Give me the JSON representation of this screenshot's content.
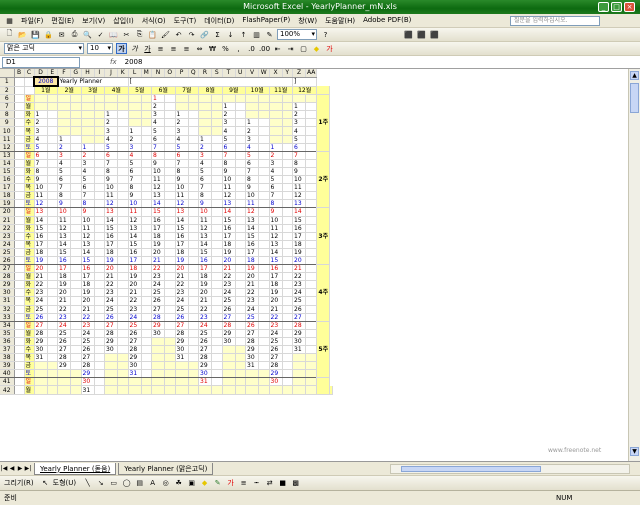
{
  "title": "Microsoft Excel - YearlyPlanner_mN.xls",
  "menu": [
    "파일(F)",
    "편집(E)",
    "보기(V)",
    "삽입(I)",
    "서식(O)",
    "도구(T)",
    "데이터(D)",
    "FlashPaper(P)",
    "창(W)",
    "도움말(H)",
    "Adobe PDF(B)"
  ],
  "help_placeholder": "질문을 입력하십시오.",
  "font_name": "맑은 고딕",
  "font_size": "10",
  "zoom": "100%",
  "name_box": "D1",
  "formula_fx": "fx",
  "formula_value": "2008",
  "cells": {
    "year": "2008",
    "planner_title": "Yearly Planner",
    "bracket_open": "[",
    "bracket_close": "]"
  },
  "columns": [
    "B",
    "C",
    "D",
    "E",
    "F",
    "G",
    "H",
    "I",
    "J",
    "K",
    "L",
    "M",
    "N",
    "O",
    "P",
    "Q",
    "R",
    "S",
    "T",
    "U",
    "V",
    "W",
    "X",
    "Y",
    "Z",
    "AA"
  ],
  "months": [
    "1월",
    "2월",
    "3월",
    "4월",
    "5월",
    "6월",
    "7월",
    "8월",
    "9월",
    "10월",
    "11월",
    "12월"
  ],
  "weekdays": [
    "일",
    "월",
    "화",
    "수",
    "목",
    "금",
    "토"
  ],
  "week_labels": [
    "1주",
    "2주",
    "3주",
    "4주",
    "5주"
  ],
  "month_days": [
    [
      "",
      "",
      "1",
      "2",
      "3",
      "4",
      "5",
      "6",
      "7",
      "8",
      "9",
      "10",
      "11",
      "12",
      "13",
      "14",
      "15",
      "16",
      "17",
      "18",
      "19",
      "20",
      "21",
      "22",
      "23",
      "24",
      "25",
      "26",
      "27",
      "28",
      "29",
      "30",
      "31",
      "",
      "",
      "",
      "",
      "",
      ""
    ],
    [
      "",
      "",
      "",
      "",
      "",
      "1",
      "2",
      "3",
      "4",
      "5",
      "6",
      "7",
      "8",
      "9",
      "10",
      "11",
      "12",
      "13",
      "14",
      "15",
      "16",
      "17",
      "18",
      "19",
      "20",
      "21",
      "22",
      "23",
      "24",
      "25",
      "26",
      "27",
      "28",
      "29",
      "",
      "",
      "",
      "",
      ""
    ],
    [
      "",
      "",
      "",
      "",
      "",
      "",
      "1",
      "2",
      "3",
      "4",
      "5",
      "6",
      "7",
      "8",
      "9",
      "10",
      "11",
      "12",
      "13",
      "14",
      "15",
      "16",
      "17",
      "18",
      "19",
      "20",
      "21",
      "22",
      "23",
      "24",
      "25",
      "26",
      "27",
      "28",
      "29",
      "30",
      "31",
      "",
      ""
    ],
    [
      "",
      "",
      "1",
      "2",
      "3",
      "4",
      "5",
      "6",
      "7",
      "8",
      "9",
      "10",
      "11",
      "12",
      "13",
      "14",
      "15",
      "16",
      "17",
      "18",
      "19",
      "20",
      "21",
      "22",
      "23",
      "24",
      "25",
      "26",
      "27",
      "28",
      "29",
      "30",
      "",
      "",
      "",
      "",
      "",
      ""
    ],
    [
      "",
      "",
      "",
      "",
      "1",
      "2",
      "3",
      "4",
      "5",
      "6",
      "7",
      "8",
      "9",
      "10",
      "11",
      "12",
      "13",
      "14",
      "15",
      "16",
      "17",
      "18",
      "19",
      "20",
      "21",
      "22",
      "23",
      "24",
      "25",
      "26",
      "27",
      "28",
      "29",
      "30",
      "31",
      "",
      "",
      ""
    ],
    [
      "1",
      "2",
      "3",
      "4",
      "5",
      "6",
      "7",
      "8",
      "9",
      "10",
      "11",
      "12",
      "13",
      "14",
      "15",
      "16",
      "17",
      "18",
      "19",
      "20",
      "21",
      "22",
      "23",
      "24",
      "25",
      "26",
      "27",
      "28",
      "29",
      "30",
      "",
      "",
      "",
      "",
      "",
      "",
      ""
    ],
    [
      "",
      "",
      "1",
      "2",
      "3",
      "4",
      "5",
      "6",
      "7",
      "8",
      "9",
      "10",
      "11",
      "12",
      "13",
      "14",
      "15",
      "16",
      "17",
      "18",
      "19",
      "20",
      "21",
      "22",
      "23",
      "24",
      "25",
      "26",
      "27",
      "28",
      "29",
      "30",
      "31",
      "",
      "",
      "",
      ""
    ],
    [
      "",
      "",
      "",
      "",
      "",
      "1",
      "2",
      "3",
      "4",
      "5",
      "6",
      "7",
      "8",
      "9",
      "10",
      "11",
      "12",
      "13",
      "14",
      "15",
      "16",
      "17",
      "18",
      "19",
      "20",
      "21",
      "22",
      "23",
      "24",
      "25",
      "26",
      "27",
      "28",
      "29",
      "30",
      "31",
      ""
    ],
    [
      "",
      "1",
      "2",
      "3",
      "4",
      "5",
      "6",
      "7",
      "8",
      "9",
      "10",
      "11",
      "12",
      "13",
      "14",
      "15",
      "16",
      "17",
      "18",
      "19",
      "20",
      "21",
      "22",
      "23",
      "24",
      "25",
      "26",
      "27",
      "28",
      "29",
      "30",
      "",
      "",
      "",
      "",
      "",
      ""
    ],
    [
      "",
      "",
      "",
      "1",
      "2",
      "3",
      "4",
      "5",
      "6",
      "7",
      "8",
      "9",
      "10",
      "11",
      "12",
      "13",
      "14",
      "15",
      "16",
      "17",
      "18",
      "19",
      "20",
      "21",
      "22",
      "23",
      "24",
      "25",
      "26",
      "27",
      "28",
      "29",
      "30",
      "31",
      "",
      "",
      ""
    ],
    [
      "",
      "",
      "",
      "",
      "",
      "",
      "1",
      "2",
      "3",
      "4",
      "5",
      "6",
      "7",
      "8",
      "9",
      "10",
      "11",
      "12",
      "13",
      "14",
      "15",
      "16",
      "17",
      "18",
      "19",
      "20",
      "21",
      "22",
      "23",
      "24",
      "25",
      "26",
      "27",
      "28",
      "29",
      "30",
      ""
    ],
    [
      "",
      "1",
      "2",
      "3",
      "4",
      "5",
      "6",
      "7",
      "8",
      "9",
      "10",
      "11",
      "12",
      "13",
      "14",
      "15",
      "16",
      "17",
      "18",
      "19",
      "20",
      "21",
      "22",
      "23",
      "24",
      "25",
      "26",
      "27",
      "28",
      "29",
      "30",
      "31",
      "",
      "",
      "",
      "",
      ""
    ]
  ],
  "sheet_tabs": [
    "Yearly Planner (돋움)",
    "Yearly Planner (맑은고딕)"
  ],
  "draw_label": "그리기(R)",
  "shape_label": "도형(U)",
  "status_left": "준비",
  "status_num": "NUM",
  "watermark": "www.freenote.net"
}
